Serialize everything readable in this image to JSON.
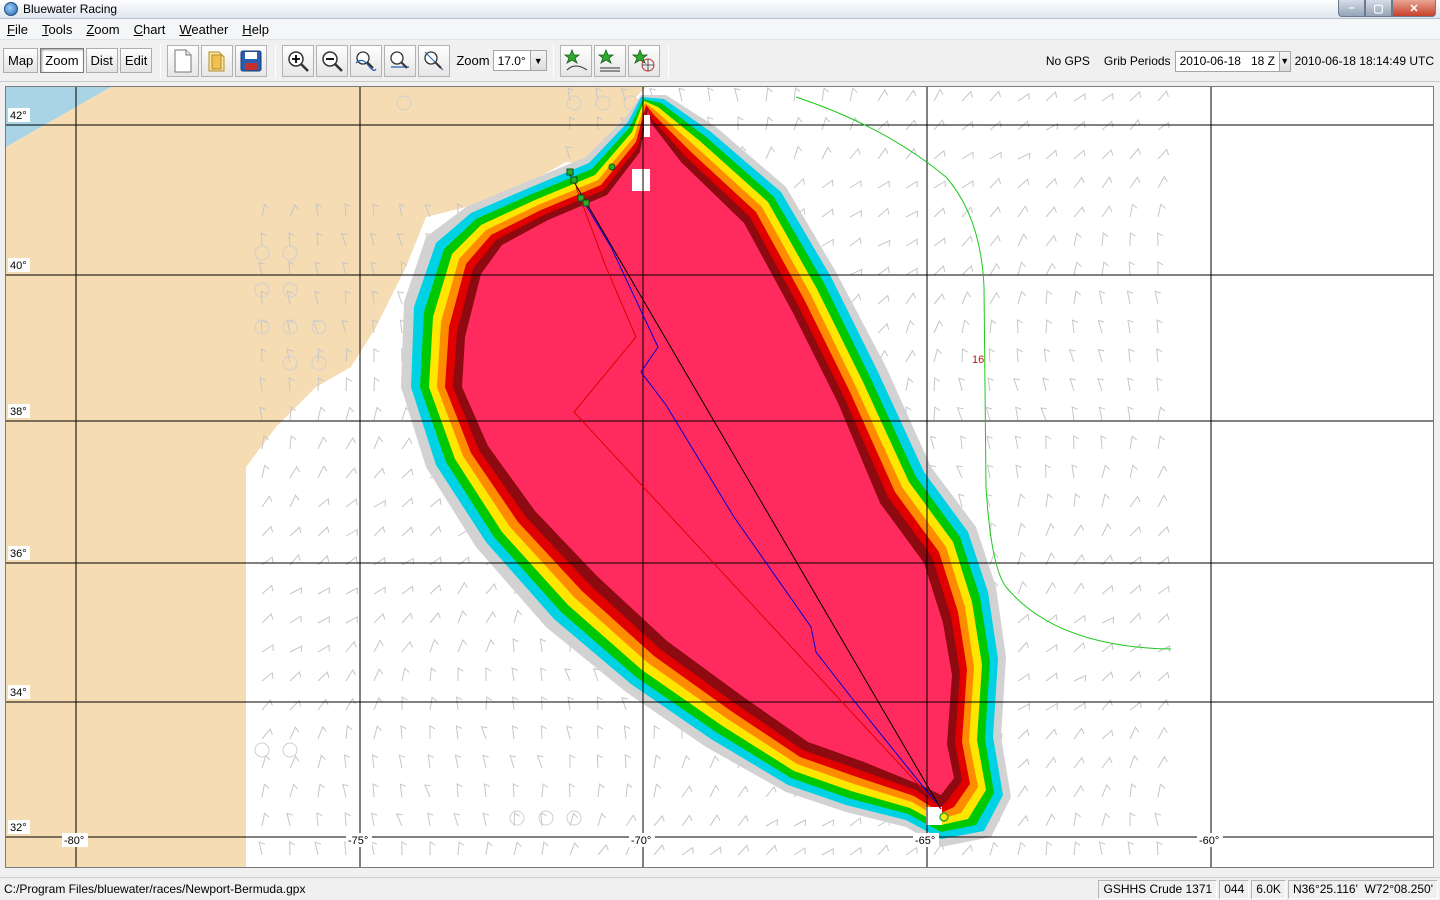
{
  "window": {
    "title": "Bluewater Racing",
    "controls": {
      "minimize": "–",
      "maximize": "▢",
      "close": "✕"
    }
  },
  "menu": [
    {
      "label": "File",
      "accel": "F",
      "rest": "ile"
    },
    {
      "label": "Tools",
      "accel": "T",
      "rest": "ools"
    },
    {
      "label": "Zoom",
      "accel": "Z",
      "rest": "oom"
    },
    {
      "label": "Chart",
      "accel": "C",
      "rest": "hart"
    },
    {
      "label": "Weather",
      "accel": "W",
      "rest": "eather"
    },
    {
      "label": "Help",
      "accel": "H",
      "rest": "elp"
    }
  ],
  "toolbar": {
    "mode_buttons": [
      {
        "label": "Map",
        "active": false
      },
      {
        "label": "Zoom",
        "active": true
      },
      {
        "label": "Dist",
        "active": false
      },
      {
        "label": "Edit",
        "active": false
      }
    ],
    "file_icons": [
      "new-file-icon",
      "open-folder-icon",
      "save-disk-icon"
    ],
    "zoom_icons": [
      "zoom-in-icon",
      "zoom-out-icon",
      "zoom-route-icon",
      "zoom-fit-icon",
      "zoom-previous-icon"
    ],
    "zoom_label": "Zoom",
    "zoom_value": "17.0°",
    "route_icons": [
      "waypoint-star-icon",
      "route-star-icon",
      "polar-star-icon"
    ],
    "gps_status": "No GPS",
    "grib_label": "Grib Periods",
    "grib_value": "2010-06-18   18 Z",
    "timestamp": "2010-06-18 18:14:49 UTC"
  },
  "map": {
    "lat_labels": [
      "42°",
      "40°",
      "38°",
      "36°",
      "34°",
      "32°"
    ],
    "lon_labels": [
      "-80°",
      "-75°",
      "-70°",
      "-65°",
      "-60°"
    ],
    "isochrone_label": "16",
    "colors": {
      "land": "#f5dcb3",
      "water_inset": "#a8d4e6",
      "isochrone_core": "#ff2b5e",
      "band_dark_red": "#8c0a10",
      "band_red": "#e00000",
      "band_orange": "#ff8c00",
      "band_yellow": "#ffe600",
      "band_green": "#00c800",
      "band_cyan": "#00d2e6",
      "band_grey": "#d2d2d2",
      "route_blue": "#0000d0",
      "route_red": "#e00000",
      "route_black": "#000000",
      "contour_green": "#1ec81e"
    }
  },
  "status": {
    "path": "C:/Program Files/bluewater/races/Newport-Bermuda.gpx",
    "coastline": "GSHHS Crude 1371",
    "heading": "044",
    "scale": "6.0K",
    "position": "N36°25.116'  W72°08.250'"
  }
}
